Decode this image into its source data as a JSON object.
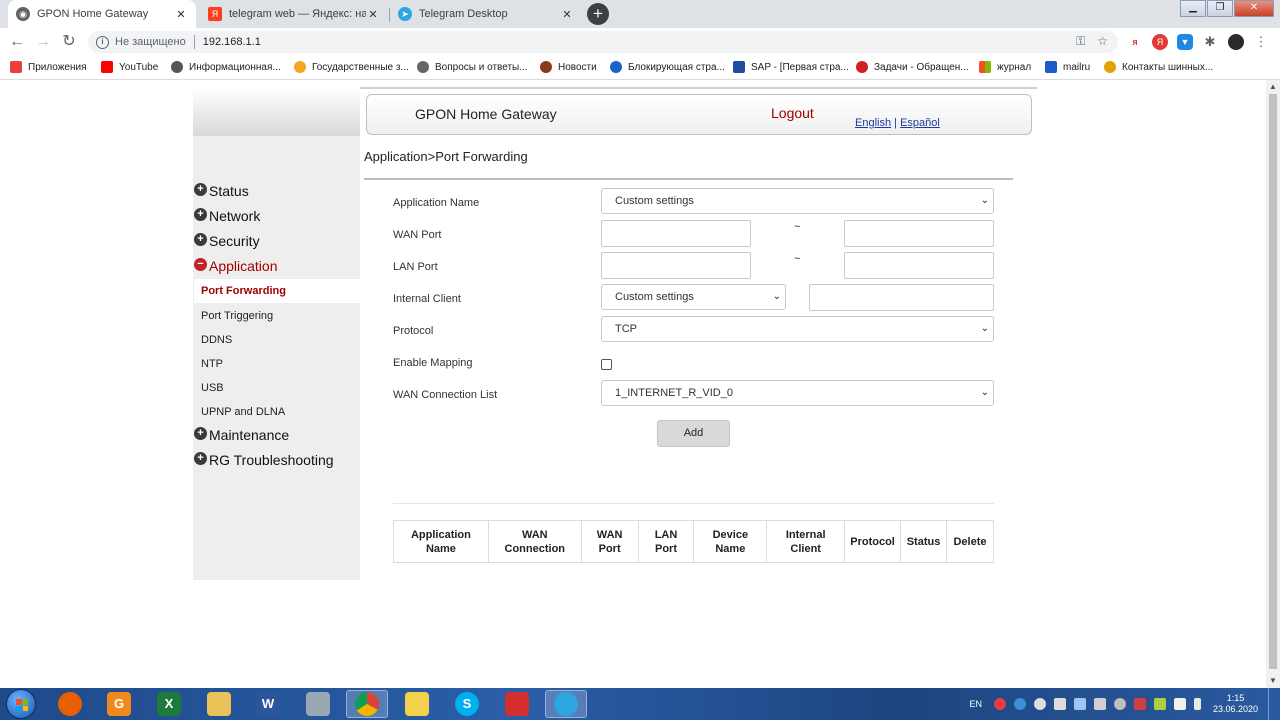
{
  "browser": {
    "tabs": [
      {
        "title": "GPON Home Gateway",
        "active": true,
        "icon": "chrome-globe-icon"
      },
      {
        "title": "telegram web — Яндекс: нашлос",
        "active": false,
        "icon": "yandex-icon"
      },
      {
        "title": "Telegram Desktop",
        "active": false,
        "icon": "telegram-icon"
      }
    ],
    "tab_close_glyph": "✕",
    "new_tab_glyph": "+",
    "window_controls": {
      "minimize": "▁",
      "restore": "❐",
      "close": "✕"
    },
    "nav": {
      "back": "←",
      "forward": "→",
      "reload": "↻"
    },
    "address": {
      "security_text": "Не защищено",
      "url": "192.168.1.1"
    },
    "omnibox_icons": {
      "key": "⚿",
      "star": "☆"
    },
    "extensions": [
      "я",
      "Я",
      "▼",
      "✱",
      "",
      "⋮"
    ],
    "bookmarks": [
      {
        "label": "Приложения",
        "icon": "apps-grid-icon",
        "color": "#e94235"
      },
      {
        "label": "YouTube",
        "icon": "youtube-icon",
        "color": "#ff0000"
      },
      {
        "label": "Информационная...",
        "icon": "globe-icon",
        "color": "#555555"
      },
      {
        "label": "Государственные з...",
        "icon": "gov-icon",
        "color": "#f4a522"
      },
      {
        "label": "Вопросы и ответы...",
        "icon": "globe-icon",
        "color": "#666666"
      },
      {
        "label": "Новости",
        "icon": "news-icon",
        "color": "#8b3a1a"
      },
      {
        "label": "Блокирующая стра...",
        "icon": "eye-icon",
        "color": "#1a63c9"
      },
      {
        "label": "SAP - [Первая стра...",
        "icon": "sap-icon",
        "color": "#1b4f9c"
      },
      {
        "label": "Задачи - Обращен...",
        "icon": "tasks-icon",
        "color": "#d02020"
      },
      {
        "label": "журнал",
        "icon": "windows-icon",
        "color": "#f25022"
      },
      {
        "label": "mailru",
        "icon": "mail-icon",
        "color": "#1a5dc4"
      },
      {
        "label": "Контакты шинных...",
        "icon": "contacts-icon",
        "color": "#e5a100"
      }
    ]
  },
  "gateway": {
    "header": {
      "title": "GPON Home Gateway",
      "logout": "Logout",
      "lang_en": "English",
      "lang_sep": "|",
      "lang_es": "Español"
    },
    "breadcrumb": "Application>Port Forwarding",
    "menu": [
      {
        "label": "Status",
        "state": "collapsed"
      },
      {
        "label": "Network",
        "state": "collapsed"
      },
      {
        "label": "Security",
        "state": "collapsed"
      },
      {
        "label": "Application",
        "state": "expanded"
      },
      {
        "label": "Maintenance",
        "state": "collapsed"
      },
      {
        "label": "RG Troubleshooting",
        "state": "collapsed"
      }
    ],
    "menu_plus": "+",
    "menu_minus": "−",
    "submenu": [
      {
        "label": "Port Forwarding",
        "selected": true
      },
      {
        "label": "Port Triggering",
        "selected": false
      },
      {
        "label": "DDNS",
        "selected": false
      },
      {
        "label": "NTP",
        "selected": false
      },
      {
        "label": "USB",
        "selected": false
      },
      {
        "label": "UPNP and DLNA",
        "selected": false
      }
    ],
    "form": {
      "app_name_label": "Application Name",
      "app_name_value": "Custom settings",
      "wan_port_label": "WAN Port",
      "wan_port_start": "",
      "wan_port_end": "",
      "lan_port_label": "LAN Port",
      "lan_port_start": "",
      "lan_port_end": "",
      "range_sep": "~",
      "internal_client_label": "Internal Client",
      "internal_client_value": "Custom settings",
      "internal_client_ip": "",
      "protocol_label": "Protocol",
      "protocol_value": "TCP",
      "enable_mapping_label": "Enable Mapping",
      "enable_mapping_checked": false,
      "wan_conn_label": "WAN Connection List",
      "wan_conn_value": "1_INTERNET_R_VID_0",
      "add_button": "Add",
      "dropdown_caret": "⌄"
    },
    "table": {
      "headers": [
        [
          "Application",
          "Name"
        ],
        [
          "WAN",
          "Connection"
        ],
        [
          "WAN",
          "Port"
        ],
        [
          "LAN",
          "Port"
        ],
        [
          "Device",
          "Name"
        ],
        [
          "Internal",
          "Client"
        ],
        [
          "Protocol"
        ],
        [
          "Status"
        ],
        [
          "Delete"
        ]
      ],
      "rows": []
    }
  },
  "taskbar": {
    "apps": [
      {
        "name": "firefox",
        "glyph": "",
        "color": "#e66000"
      },
      {
        "name": "gpdf",
        "glyph": "G",
        "color": "#f08a1c"
      },
      {
        "name": "excel",
        "glyph": "X",
        "color": "#1d7a3a"
      },
      {
        "name": "explorer",
        "glyph": "",
        "color": "#e8c35a"
      },
      {
        "name": "word",
        "glyph": "W",
        "color": "#2b579a"
      },
      {
        "name": "calculator",
        "glyph": "",
        "color": "#9aa7b5"
      },
      {
        "name": "chrome",
        "glyph": "",
        "color": "#e0e0e0"
      },
      {
        "name": "notes",
        "glyph": "",
        "color": "#f2d24a"
      },
      {
        "name": "skype",
        "glyph": "S",
        "color": "#00aff0"
      },
      {
        "name": "shield",
        "glyph": "",
        "color": "#d42f2f"
      },
      {
        "name": "telegram",
        "glyph": "",
        "color": "#2ca5e0"
      }
    ],
    "tray_lang": "EN",
    "time": "1:15",
    "date": "23.06.2020"
  }
}
